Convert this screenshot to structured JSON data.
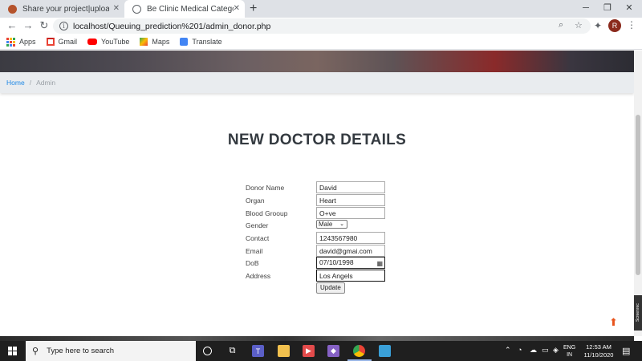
{
  "browser": {
    "tabs": [
      {
        "title": "Share your project|upload project",
        "active": false
      },
      {
        "title": "Be Clinic Medical Category Boots",
        "active": true
      }
    ],
    "url": "localhost/Queuing_prediction%201/admin_donor.php",
    "profile_initial": "R",
    "bookmarks": [
      "Apps",
      "Gmail",
      "YouTube",
      "Maps",
      "Translate"
    ]
  },
  "page": {
    "breadcrumb": {
      "home": "Home",
      "separator": "/",
      "current": "Admin"
    },
    "heading": "NEW DOCTOR DETAILS",
    "form": {
      "labels": {
        "donor_name": "Donor Name",
        "organ": "Organ",
        "blood_group": "Blood Grooup",
        "gender": "Gender",
        "contact": "Contact",
        "email": "Email",
        "dob": "DoB",
        "address": "Address"
      },
      "values": {
        "donor_name": "David",
        "organ": "Heart",
        "blood_group": "O+ve",
        "gender": "Male",
        "contact": "1243567980",
        "email": "david@gmai.com",
        "dob": "07/10/1998",
        "address": "Los Angels"
      },
      "submit_label": "Update"
    },
    "side_badge": "Screenrec"
  },
  "taskbar": {
    "search_placeholder": "Type here to search",
    "language": {
      "code": "ENG",
      "region": "IN"
    },
    "time": "12:53 AM",
    "date": "11/10/2020"
  },
  "colors": {
    "breadcrumb_link": "#1e88e5",
    "heading": "#343a40",
    "scroll_top_arrow": "#e8541c"
  }
}
